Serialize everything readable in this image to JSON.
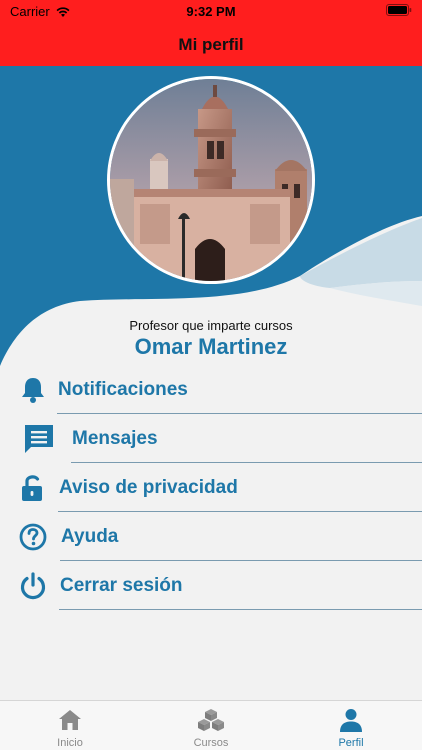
{
  "status_bar": {
    "carrier": "Carrier",
    "time": "9:32 PM"
  },
  "navbar": {
    "title": "Mi perfil"
  },
  "profile": {
    "role": "Profesor que imparte cursos",
    "name": "Omar Martinez"
  },
  "menu": {
    "items": [
      {
        "label": "Notificaciones",
        "icon": "bell-icon"
      },
      {
        "label": "Mensajes",
        "icon": "message-icon"
      },
      {
        "label": "Aviso de privacidad",
        "icon": "unlock-icon"
      },
      {
        "label": "Ayuda",
        "icon": "help-icon"
      },
      {
        "label": "Cerrar sesión",
        "icon": "power-icon"
      }
    ]
  },
  "tabbar": {
    "tabs": [
      {
        "label": "Inicio",
        "icon": "home-icon",
        "active": false
      },
      {
        "label": "Cursos",
        "icon": "boxes-icon",
        "active": false
      },
      {
        "label": "Perfil",
        "icon": "person-icon",
        "active": true
      }
    ]
  },
  "colors": {
    "header_red": "#ff1e1e",
    "brand_blue": "#1e77a8",
    "wave_light": "#c8dbe6",
    "inactive_gray": "#8a8a8a"
  }
}
